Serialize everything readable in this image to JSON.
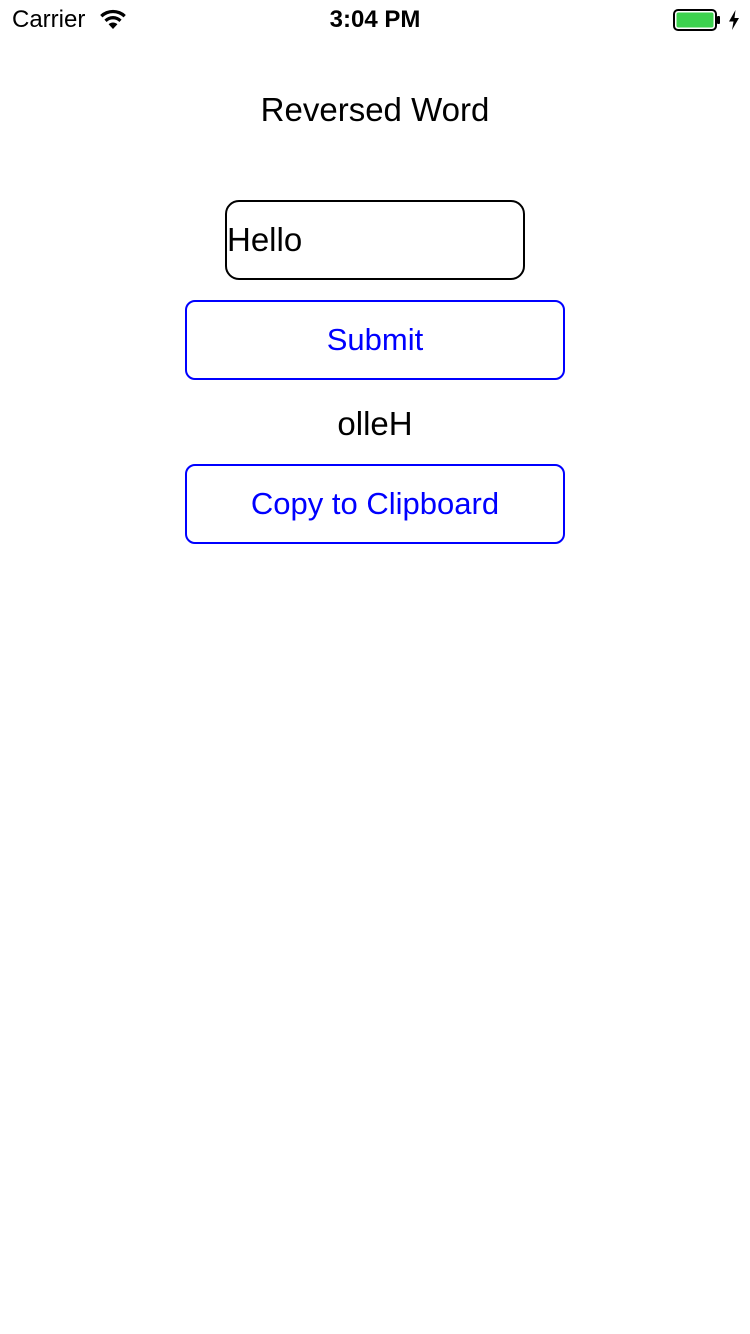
{
  "status_bar": {
    "carrier": "Carrier",
    "time": "3:04 PM",
    "battery_level": 1.0,
    "battery_color": "#3cd24e",
    "charging": true,
    "icons": [
      "wifi-icon",
      "battery-icon",
      "charging-bolt-icon"
    ]
  },
  "screen": {
    "title": "Reversed Word",
    "input": {
      "value": "Hello"
    },
    "submit_label": "Submit",
    "result": "olleH",
    "copy_label": "Copy to Clipboard"
  },
  "colors": {
    "accent": "#0000ff",
    "text": "#000000",
    "background": "#ffffff"
  }
}
